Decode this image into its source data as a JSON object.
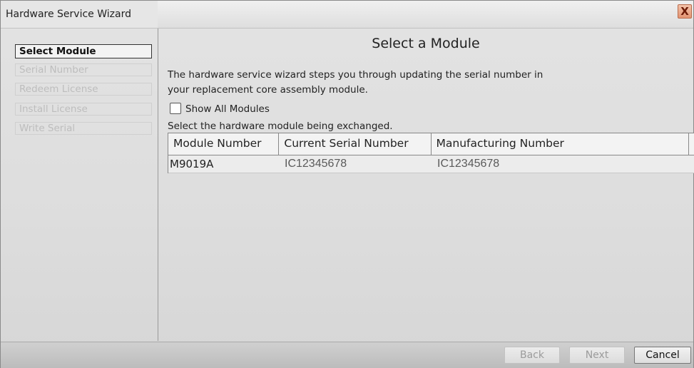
{
  "window": {
    "title": "Hardware Service Wizard",
    "close_label": "X"
  },
  "steps": [
    {
      "label": "Select Module",
      "state": "active"
    },
    {
      "label": "Serial Number",
      "state": "disabled"
    },
    {
      "label": "Redeem License",
      "state": "disabled"
    },
    {
      "label": "Install License",
      "state": "disabled"
    },
    {
      "label": "Write Serial",
      "state": "disabled"
    }
  ],
  "main": {
    "heading": "Select a Module",
    "description_line1": "The hardware service wizard steps you through updating the serial number in",
    "description_line2": "your replacement core assembly module.",
    "show_all_label": "Show All Modules",
    "show_all_checked": false,
    "instruction": "Select the hardware module being exchanged."
  },
  "table": {
    "columns": [
      "Module Number",
      "Current Serial Number",
      "Manufacturing Number"
    ],
    "rows": [
      [
        "M9019A",
        "IC12345678",
        "IC12345678"
      ]
    ]
  },
  "footer": {
    "back_label": "Back",
    "next_label": "Next",
    "cancel_label": "Cancel"
  }
}
